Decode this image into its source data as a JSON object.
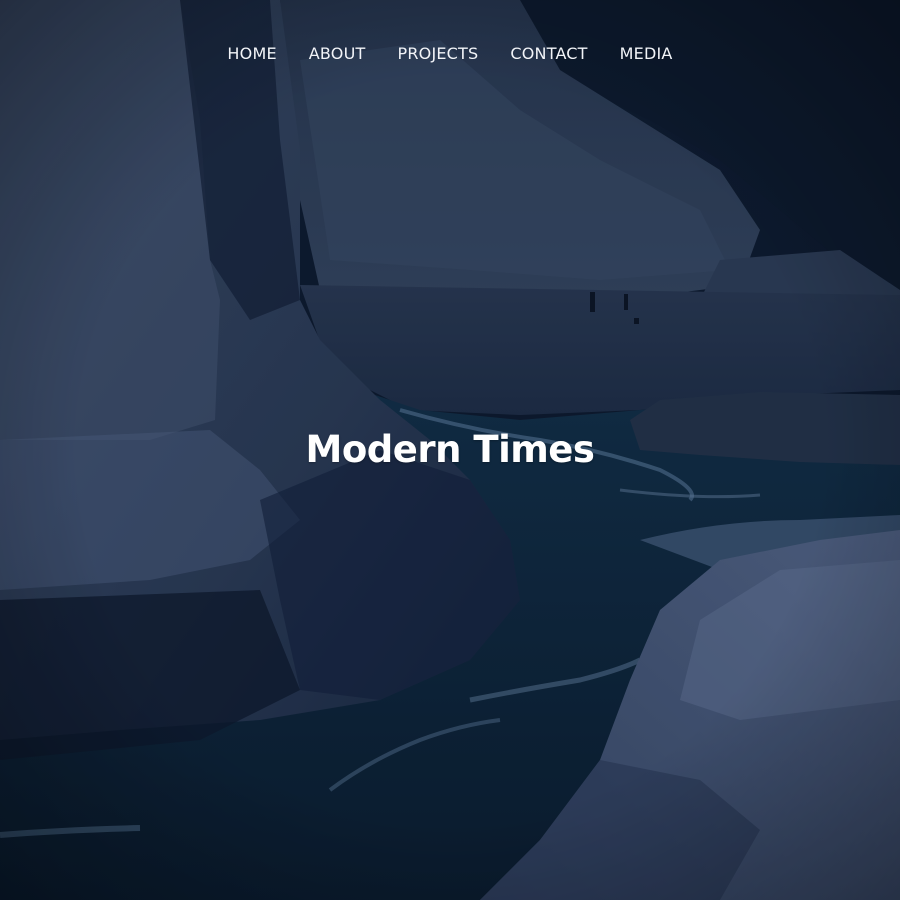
{
  "nav": {
    "items": [
      {
        "label": "HOME"
      },
      {
        "label": "ABOUT"
      },
      {
        "label": "PROJECTS"
      },
      {
        "label": "CONTACT"
      },
      {
        "label": "MEDIA"
      }
    ]
  },
  "hero": {
    "title": "Modern Times"
  },
  "colors": {
    "overlay": "#0b1a33",
    "text": "#ffffff"
  }
}
